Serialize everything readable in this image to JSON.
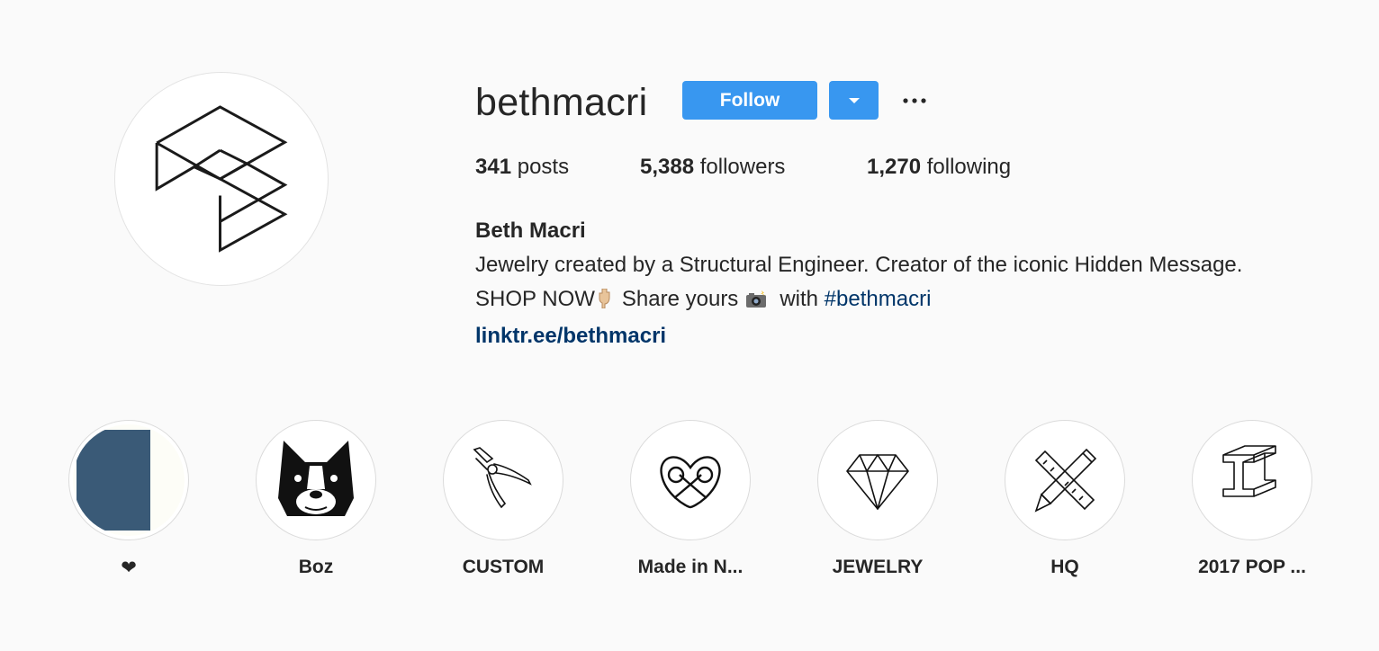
{
  "profile": {
    "username": "bethmacri",
    "follow_label": "Follow",
    "more_label": "···",
    "avatar_icon": "geometric-logo-icon"
  },
  "stats": {
    "posts_count": "341",
    "posts_label": "posts",
    "followers_count": "5,388",
    "followers_label": "followers",
    "following_count": "1,270",
    "following_label": "following"
  },
  "bio": {
    "full_name": "Beth Macri",
    "line1": "Jewelry created by a Structural Engineer. Creator of the iconic Hidden Message.",
    "shop_now": "SHOP NOW",
    "share_yours": "Share yours",
    "with": "with",
    "hashtag": "#bethmacri",
    "link": "linktr.ee/bethmacri"
  },
  "highlights": [
    {
      "label": "❤",
      "icon": "blue-photo-thumbnail"
    },
    {
      "label": "Boz",
      "icon": "boston-terrier-icon"
    },
    {
      "label": "CUSTOM",
      "icon": "pliers-icon"
    },
    {
      "label": "Made in N...",
      "icon": "pretzel-icon"
    },
    {
      "label": "JEWELRY",
      "icon": "diamond-icon"
    },
    {
      "label": "HQ",
      "icon": "ruler-pencil-icon"
    },
    {
      "label": "2017 POP ...",
      "icon": "steel-beam-icon"
    }
  ],
  "colors": {
    "background": "#fafafa",
    "accent": "#3897f0",
    "link": "#003569",
    "text": "#262626"
  }
}
